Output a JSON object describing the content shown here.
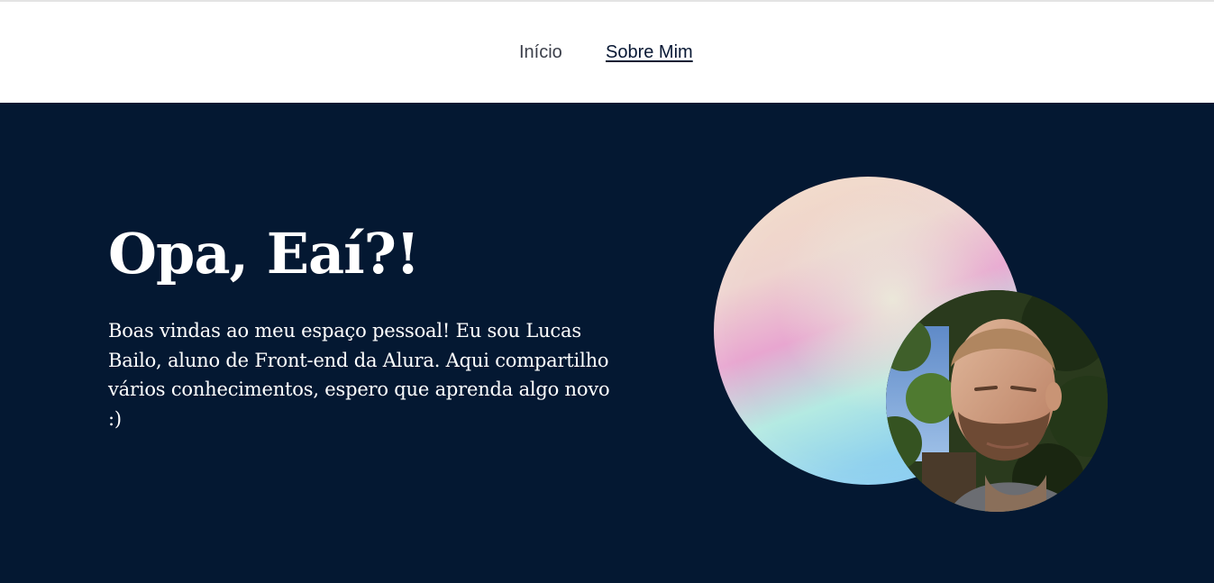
{
  "nav": {
    "items": [
      {
        "label": "Início",
        "active": false
      },
      {
        "label": "Sobre Mim",
        "active": true
      }
    ]
  },
  "hero": {
    "title": "Opa, Eaí?!",
    "description": "Boas vindas ao meu espaço pessoal! Eu sou Lucas Bailo, aluno de Front-end da Alura. Aqui compartilho vários conhecimentos, espero que aprenda algo novo :)"
  },
  "colors": {
    "hero_background": "#041832",
    "nav_background": "#ffffff",
    "nav_text": "#3b3f4a",
    "hero_text": "#ffffff"
  },
  "icons": {
    "avatar": "profile-photo",
    "decoration": "gradient-orb"
  }
}
